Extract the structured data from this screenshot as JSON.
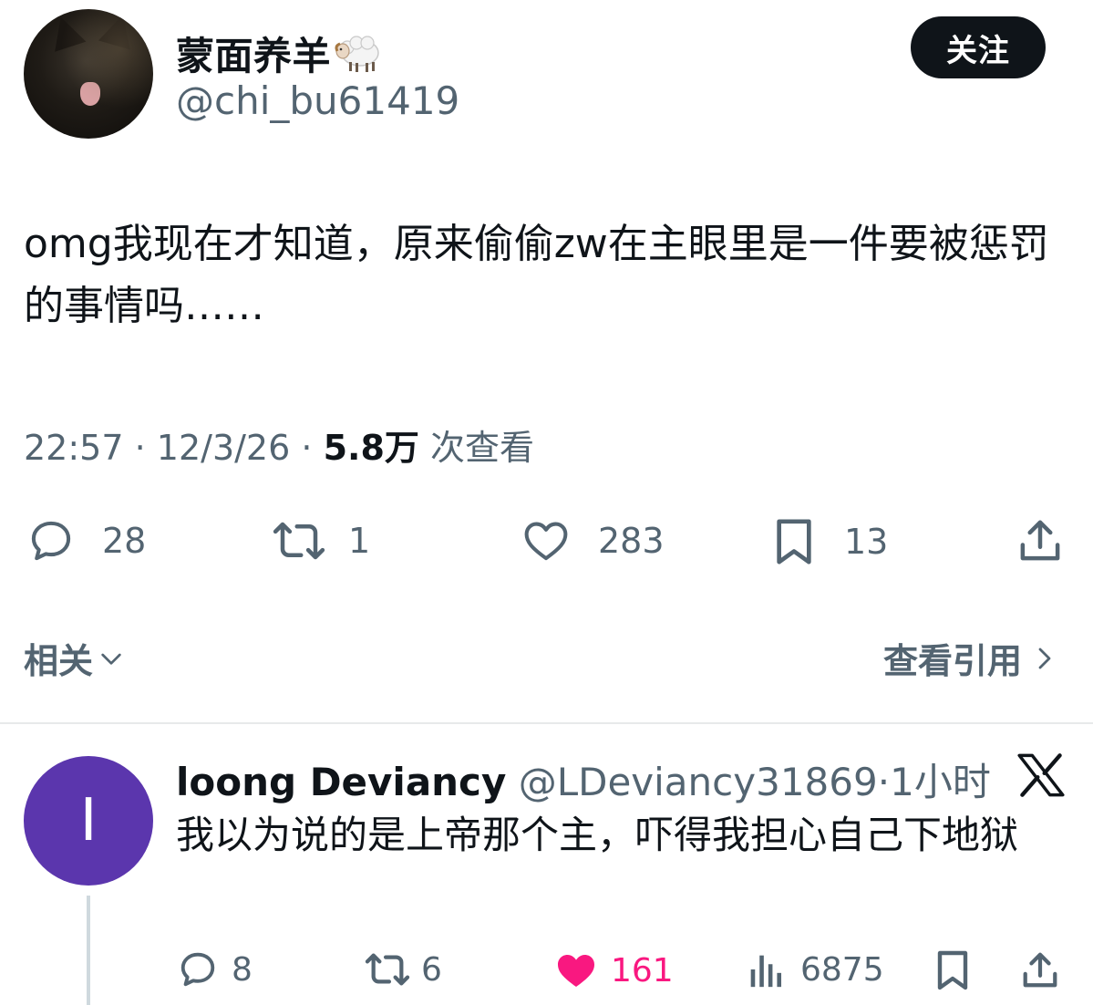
{
  "tweet": {
    "display_name": "蒙面养羊",
    "handle": "@chi_bu61419",
    "follow_label": "关注",
    "text": "omg我现在才知道，原来偷偷zw在主眼里是一件要被惩罚的事情吗……",
    "time": "22:57",
    "date": "12/3/26",
    "sep": "·",
    "views_count": "5.8万",
    "views_label": "次查看",
    "stats": {
      "replies": "28",
      "retweets": "1",
      "likes": "283",
      "bookmarks": "13"
    },
    "icons": [
      "reply-icon",
      "retweet-icon",
      "heart-icon",
      "bookmark-icon",
      "share-icon",
      "sheep-emoji"
    ]
  },
  "related": {
    "label": "相关",
    "view_quotes": "查看引用"
  },
  "reply": {
    "avatar_letter": "I",
    "avatar_color": "#5b36ad",
    "display_name": "loong Deviancy",
    "handle": "@LDeviancy31869",
    "sep": "·",
    "time": "1小时",
    "text": "我以为说的是上帝那个主，吓得我担心自己下地狱",
    "stats": {
      "replies": "8",
      "retweets": "6",
      "likes": "161",
      "views": "6875"
    },
    "liked": true,
    "like_color": "#f91880"
  },
  "colors": {
    "text_primary": "#0f1419",
    "text_secondary": "#536471",
    "divider": "#e7e9ea"
  }
}
